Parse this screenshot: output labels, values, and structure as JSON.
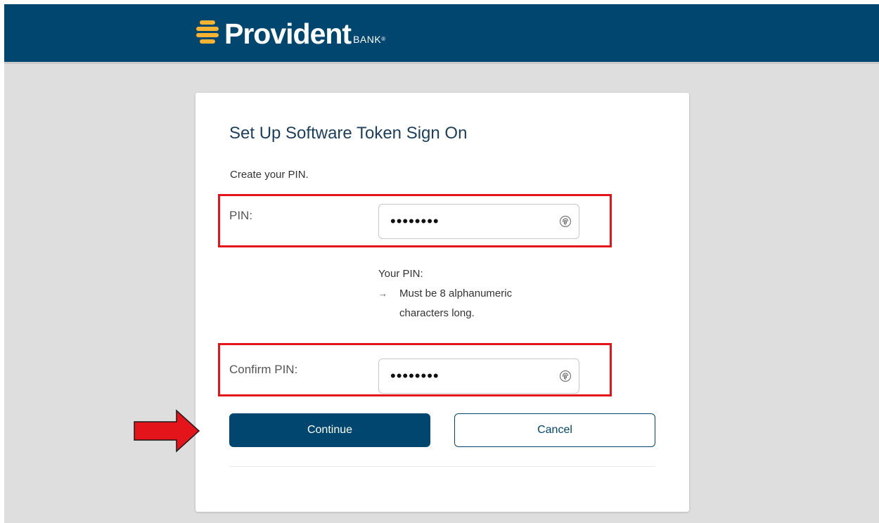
{
  "header": {
    "logo_word": "Provident",
    "logo_suffix": "BANK",
    "logo_mark": "®",
    "brand_color": "#00466e",
    "logo_accent_color": "#f6b332"
  },
  "form": {
    "title": "Set Up Software Token Sign On",
    "instruction": "Create your PIN.",
    "pin": {
      "label": "PIN:",
      "value": "••••••••"
    },
    "rules": {
      "heading": "Your PIN:",
      "items": [
        {
          "arrow": "→",
          "text": "Must be 8 alphanumeric characters long."
        }
      ]
    },
    "confirm_pin": {
      "label": "Confirm PIN:",
      "value": "••••••••"
    },
    "buttons": {
      "continue_label": "Continue",
      "cancel_label": "Cancel"
    }
  },
  "annotations": {
    "highlight_color": "#e4141b",
    "pointer_icon": "right-arrow-icon"
  }
}
